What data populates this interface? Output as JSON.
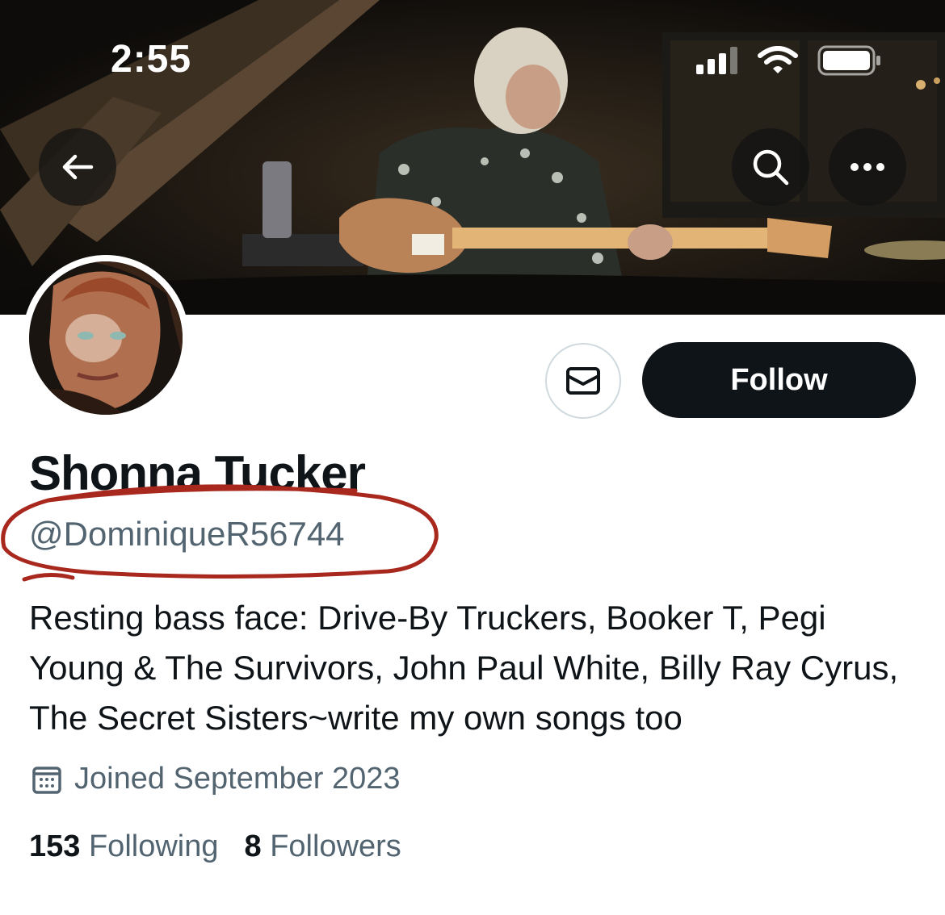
{
  "status_bar": {
    "time": "2:55",
    "icons": [
      "signal-icon",
      "wifi-icon",
      "battery-icon"
    ]
  },
  "nav": {
    "back_icon": "back-arrow-icon",
    "search_icon": "search-icon",
    "more_icon": "more-dots-icon"
  },
  "profile": {
    "display_name": "Shonna Tucker",
    "handle": "@DominiqueR56744",
    "bio": "Resting bass face: Drive-By Truckers, Booker T, Pegi Young & The Survivors, John Paul White, Billy Ray Cyrus, The Secret Sisters~write my own songs too",
    "joined": "Joined September 2023",
    "following_count": "153",
    "following_label": "Following",
    "followers_count": "8",
    "followers_label": "Followers"
  },
  "actions": {
    "message_icon": "envelope-icon",
    "follow_label": "Follow"
  },
  "colors": {
    "primary_text": "#0f1419",
    "secondary_text": "#536471",
    "follow_button_bg": "#0f1419",
    "annotation_red": "#a8281e",
    "border": "#cfd9de"
  }
}
